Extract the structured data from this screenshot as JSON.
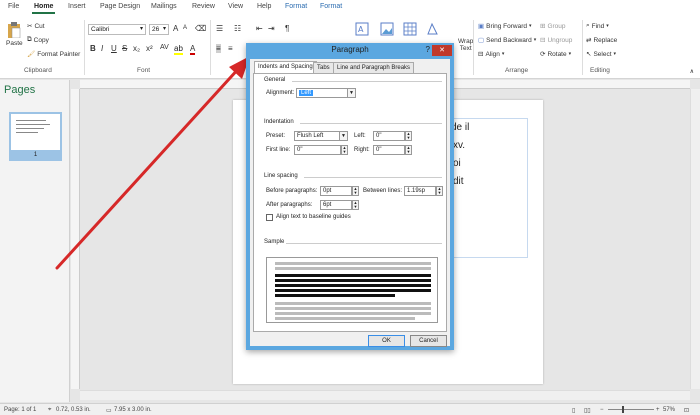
{
  "ribbon": {
    "tabs": [
      {
        "label": "File",
        "active": false
      },
      {
        "label": "Home",
        "active": true
      },
      {
        "label": "Insert",
        "active": false
      },
      {
        "label": "Page Design",
        "active": false
      },
      {
        "label": "Mailings",
        "active": false
      },
      {
        "label": "Review",
        "active": false
      },
      {
        "label": "View",
        "active": false
      },
      {
        "label": "Help",
        "active": false
      },
      {
        "label": "Format",
        "active": false
      },
      {
        "label": "Format",
        "active": false
      }
    ],
    "clipboard": {
      "paste": "Paste",
      "cut": "Cut",
      "copy": "Copy",
      "format_painter": "Format Painter",
      "group_label": "Clipboard"
    },
    "font": {
      "font_name": "Calibri",
      "font_size": "26",
      "group_label": "Font"
    },
    "paragraph": {
      "wrap_text": "Wrap",
      "wrap_text2": "Text"
    },
    "arrange": {
      "bring_forward": "Bring Forward",
      "send_backward": "Send Backward",
      "align": "Align",
      "group": "Group",
      "ungroup": "Ungroup",
      "rotate": "Rotate",
      "group_label": "Arrange"
    },
    "editing": {
      "find": "Find",
      "replace": "Replace",
      "select": "Select",
      "group_label": "Editing"
    }
  },
  "pages_pane": {
    "title": "Pages",
    "page_number": "1"
  },
  "document": {
    "lines": [
      "de il",
      "xv.",
      "oi",
      "dit"
    ]
  },
  "dialog": {
    "title": "Paragraph",
    "help": "?",
    "close": "✕",
    "tabs": [
      "Indents and Spacing",
      "Tabs",
      "Line and Paragraph Breaks"
    ],
    "general": {
      "section": "General",
      "alignment_label": "Alignment:",
      "alignment_value": "Left"
    },
    "indentation": {
      "section": "Indentation",
      "preset_label": "Preset:",
      "preset_value": "Flush Left",
      "left_label": "Left:",
      "left_value": "0\"",
      "first_line_label": "First line:",
      "first_line_value": "0\"",
      "right_label": "Right:",
      "right_value": "0\""
    },
    "line_spacing": {
      "section": "Line spacing",
      "before_label": "Before paragraphs:",
      "before_value": "0pt",
      "between_label": "Between lines:",
      "between_value": "1.19sp",
      "after_label": "After paragraphs:",
      "after_value": "6pt",
      "baseline_label": "Align text to baseline guides"
    },
    "sample": {
      "section": "Sample"
    },
    "ok": "OK",
    "cancel": "Cancel"
  },
  "status": {
    "page": "Page: 1 of 1",
    "position": "0.72, 0.53 in.",
    "size": "7.95 x 3.00 in.",
    "zoom": "57%"
  },
  "colors": {
    "accent": "#217346",
    "dialog_border": "#5ba7e0",
    "arrow": "#d62828"
  }
}
